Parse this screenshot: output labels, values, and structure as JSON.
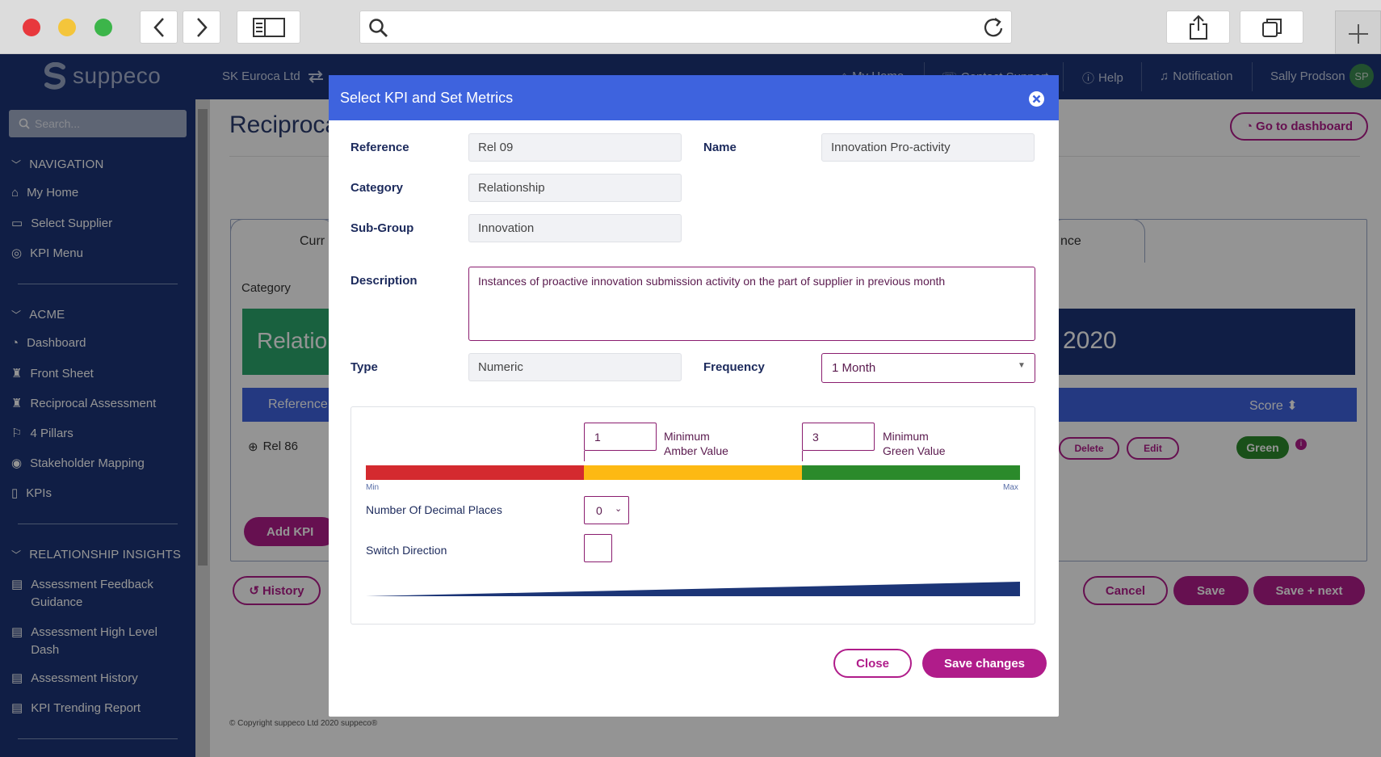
{
  "browser": {
    "url_value": "",
    "icons": [
      "back-icon",
      "forward-icon",
      "sidebar-icon",
      "search-icon",
      "reload-icon",
      "share-icon",
      "tabs-icon",
      "new-tab-icon"
    ]
  },
  "header": {
    "brand": "suppeco",
    "company": "SK Euroca Ltd",
    "links": [
      "My Home",
      "Contact Support",
      "Help",
      "Notification"
    ],
    "user_name": "Sally Prodson",
    "user_initials": "SP"
  },
  "sidebar": {
    "search_placeholder": "Search...",
    "sections": [
      {
        "title": "NAVIGATION",
        "items": [
          "My Home",
          "Select Supplier",
          "KPI Menu"
        ]
      },
      {
        "title": "ACME",
        "items": [
          "Dashboard",
          "Front Sheet",
          "Reciprocal Assessment",
          "4 Pillars",
          "Stakeholder Mapping",
          "KPIs"
        ]
      },
      {
        "title": "RELATIONSHIP INSIGHTS",
        "items": [
          "Assessment Feedback Guidance",
          "Assessment High Level Dash",
          "Assessment History",
          "KPI Trending Report"
        ]
      }
    ]
  },
  "page": {
    "title": "Reciproca",
    "go_dashboard": "Go to dashboard",
    "tab_left": "Curr",
    "tab_right": "nce",
    "category_label": "Category",
    "banner_left": "Relatio",
    "banner_right": "2020",
    "table_header_reference": "Reference",
    "table_header_score": "Score",
    "row_reference": "Rel 86",
    "row_delete": "Delete",
    "row_edit": "Edit",
    "row_score": "Green",
    "add_kpi": "Add KPI",
    "history": "History",
    "cancel": "Cancel",
    "save": "Save",
    "save_next": "Save + next",
    "copyright": "© Copyright suppeco Ltd 2020 suppeco®"
  },
  "modal": {
    "title": "Select KPI and Set Metrics",
    "reference_label": "Reference",
    "reference_value": "Rel 09",
    "name_label": "Name",
    "name_value": "Innovation Pro-activity",
    "category_label": "Category",
    "category_value": "Relationship",
    "subgroup_label": "Sub-Group",
    "subgroup_value": "Innovation",
    "description_label": "Description",
    "description_value": "Instances of proactive innovation submission activity on the part of supplier in previous month",
    "type_label": "Type",
    "type_value": "Numeric",
    "frequency_label": "Frequency",
    "frequency_value": "1 Month",
    "min_amber_value": "1",
    "min_amber_label_1": "Minimum",
    "min_amber_label_2": "Amber Value",
    "min_green_value": "3",
    "min_green_label_1": "Minimum",
    "min_green_label_2": "Green Value",
    "scale_min": "Min",
    "scale_max": "Max",
    "decimal_label": "Number Of Decimal Places",
    "decimal_value": "0",
    "switch_label": "Switch Direction",
    "switch_checked": false,
    "close_label": "Close",
    "save_label": "Save changes",
    "colors": {
      "red": "#d42a2f",
      "amber": "#fdb913",
      "green": "#2b8a2b",
      "accent": "#b01c8a",
      "header": "#3e63de"
    }
  }
}
